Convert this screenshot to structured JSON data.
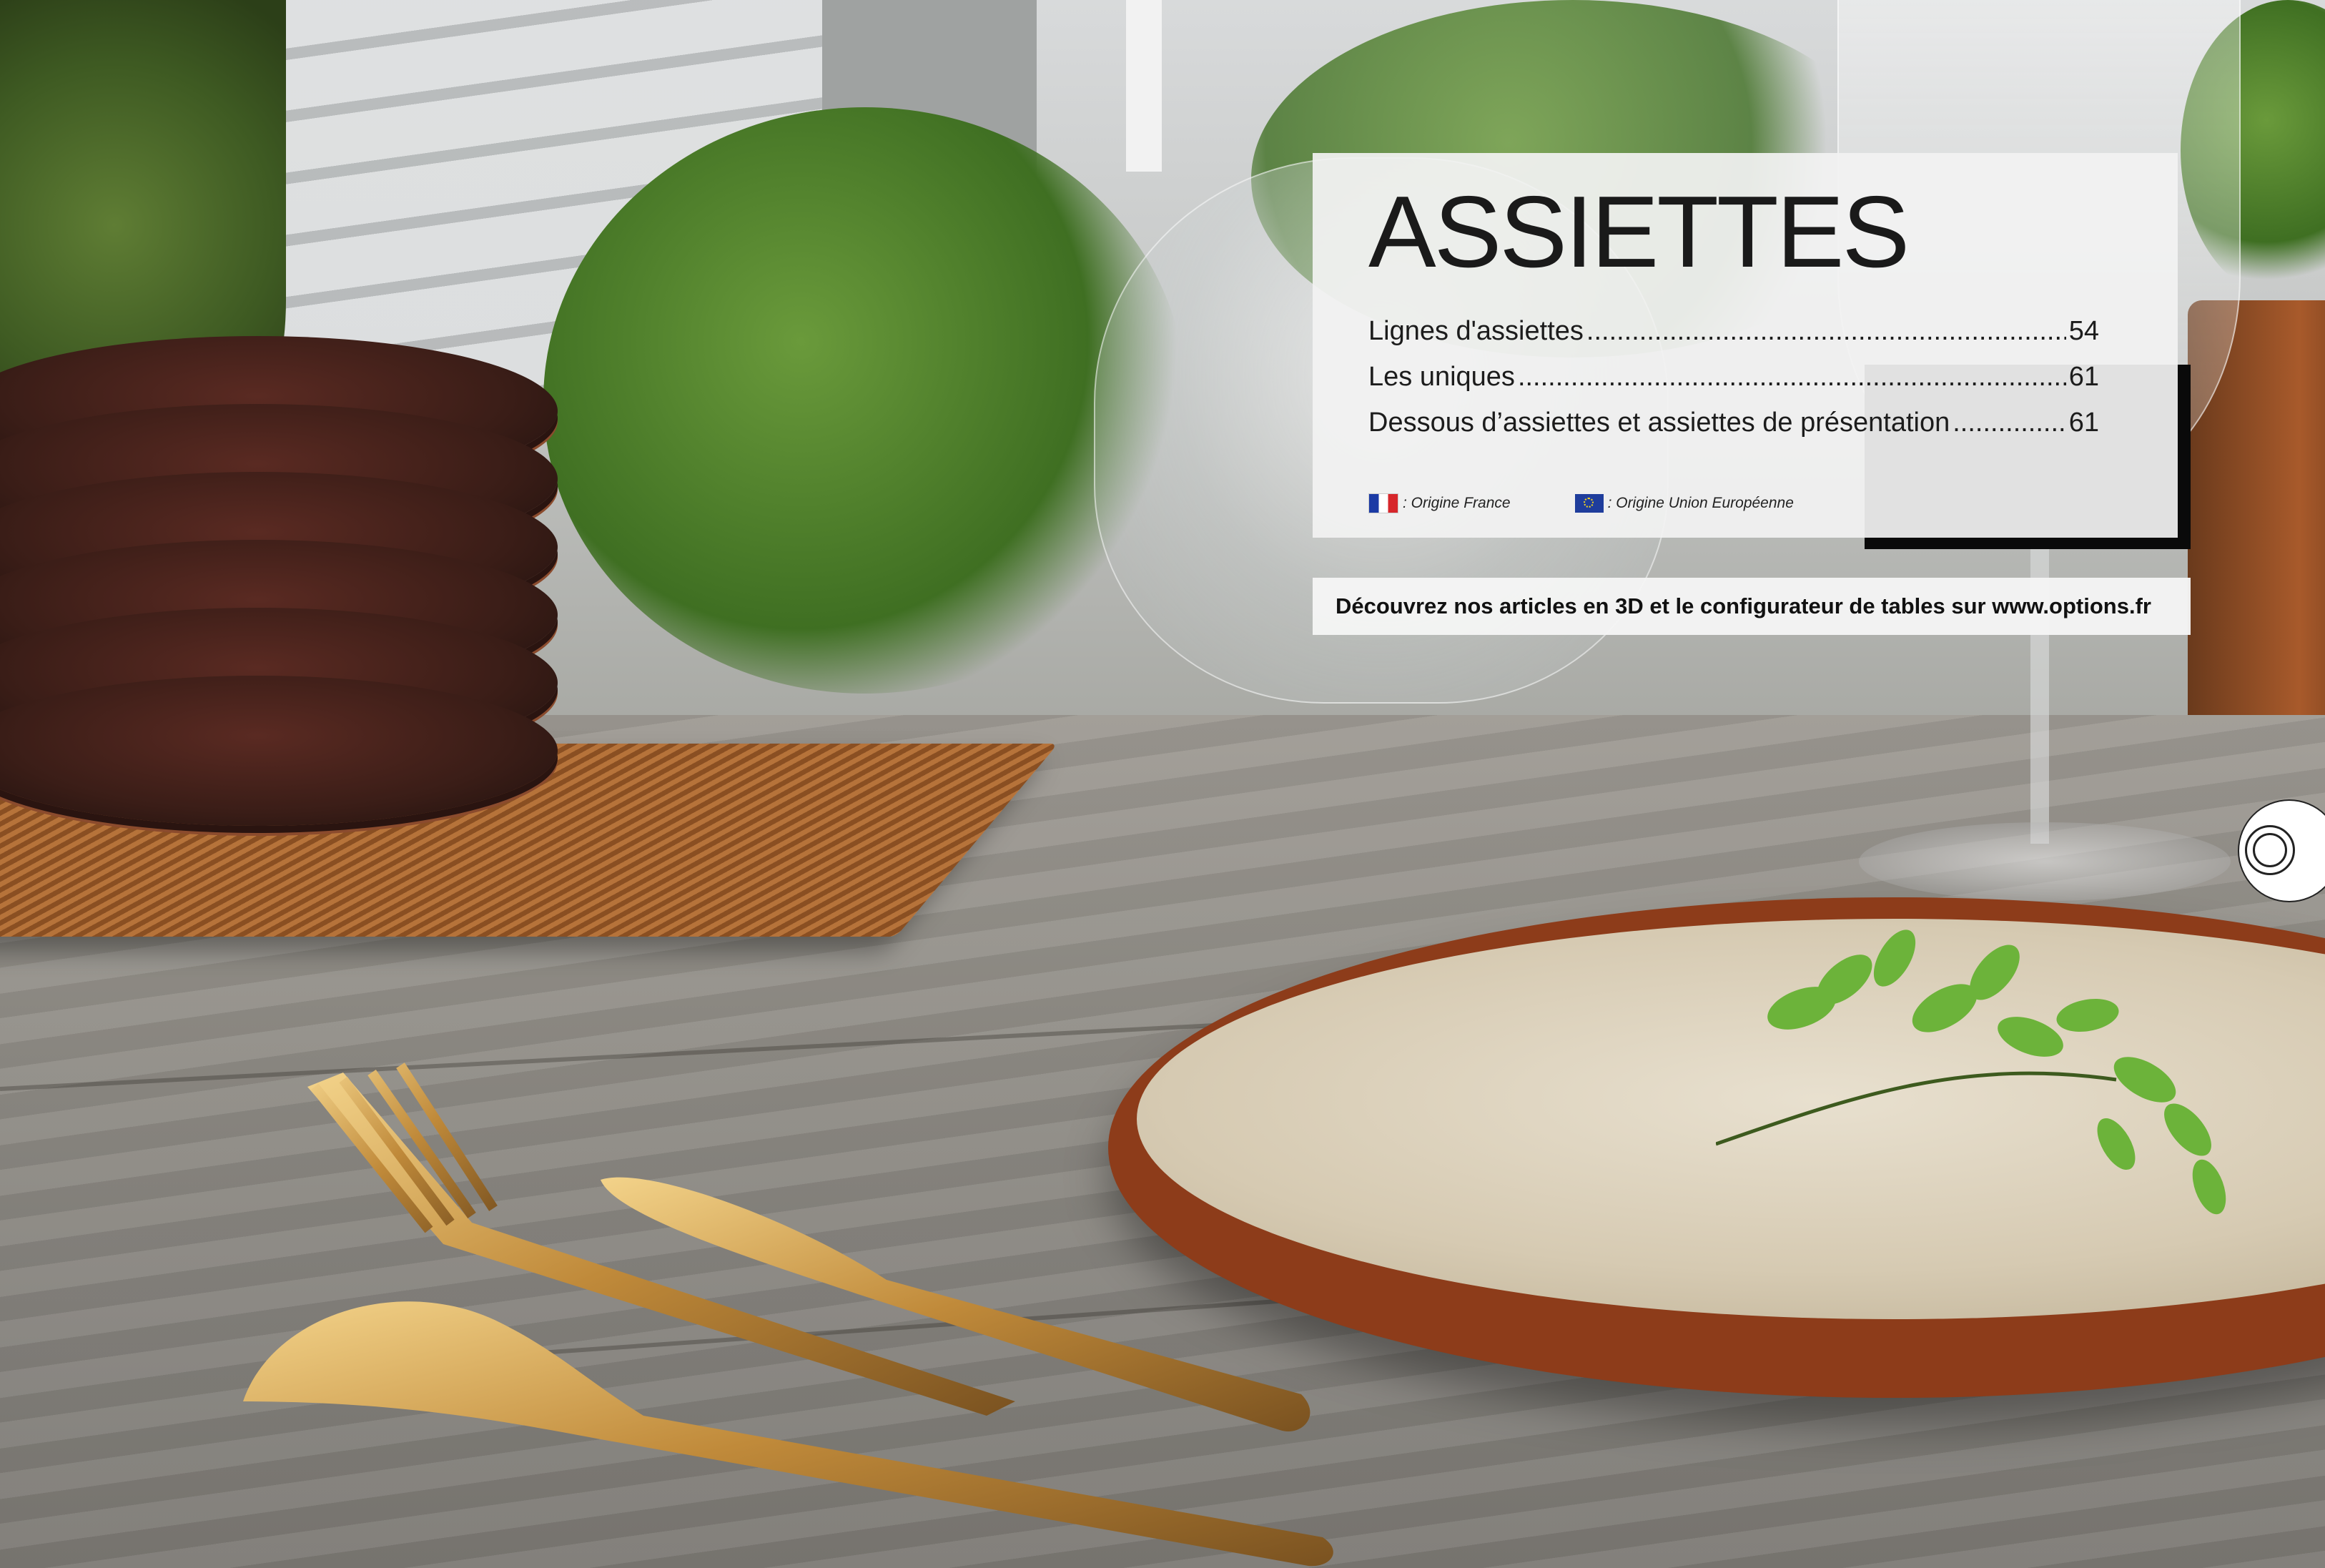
{
  "section": {
    "title": "ASSIETTES"
  },
  "toc": [
    {
      "label": "Lignes d'assiettes",
      "page": "54"
    },
    {
      "label": "Les uniques ",
      "page": "61"
    },
    {
      "label": "Dessous d’assiettes et assiettes de présentation",
      "page": "61"
    }
  ],
  "legend": {
    "france": {
      "label": ": Origine France",
      "icon": "flag-france-icon"
    },
    "eu": {
      "label": ": Origine Union Européenne",
      "icon": "flag-eu-icon"
    }
  },
  "banner": {
    "text": "Découvrez nos articles en 3D et le configurateur de tables sur www.options.fr"
  },
  "colors": {
    "card_background": "#f2f2f2",
    "text": "#1a1a1a",
    "accent_shadow": "#0a0a0a"
  }
}
